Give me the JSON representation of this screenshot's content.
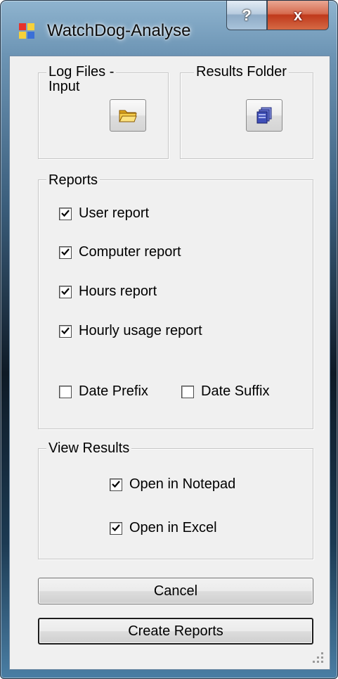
{
  "window": {
    "title": "WatchDog-Analyse",
    "help_label": "?",
    "close_label": "x",
    "app_icon": "form-window-icon"
  },
  "groups": {
    "log_files": {
      "label": "Log Files - Input",
      "label_line1": "Log Files -",
      "label_line2": "Input",
      "button_icon": "open-folder-icon"
    },
    "results_folder": {
      "label": "Results Folder",
      "button_icon": "folder-stack-icon"
    },
    "reports": {
      "label": "Reports",
      "options": [
        {
          "label": "User report",
          "checked": true
        },
        {
          "label": "Computer report",
          "checked": true
        },
        {
          "label": "Hours report",
          "checked": true
        },
        {
          "label": "Hourly usage report",
          "checked": true
        }
      ],
      "date_prefix": {
        "label": "Date Prefix",
        "checked": false
      },
      "date_suffix": {
        "label": "Date Suffix",
        "checked": false
      }
    },
    "view_results": {
      "label": "View Results",
      "options": [
        {
          "label": "Open in Notepad",
          "checked": true
        },
        {
          "label": "Open in Excel",
          "checked": true
        }
      ]
    }
  },
  "buttons": {
    "cancel": "Cancel",
    "create": "Create Reports"
  },
  "colors": {
    "client_bg": "#f0f0f0",
    "close_red": "#c0391b",
    "folder_yellow": "#f2c744",
    "folder_blue": "#3f4fb8"
  }
}
